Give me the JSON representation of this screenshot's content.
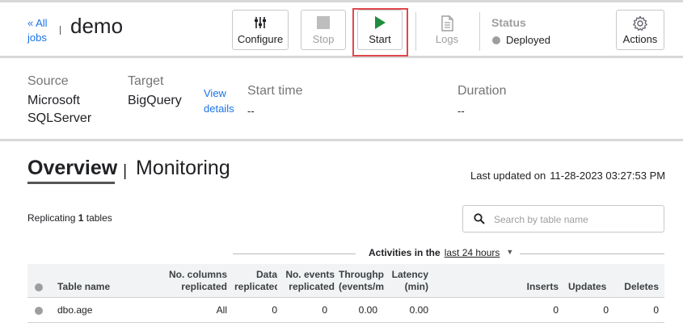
{
  "header": {
    "back_link": "« All jobs",
    "title": "demo",
    "buttons": {
      "configure": "Configure",
      "stop": "Stop",
      "start": "Start",
      "logs": "Logs",
      "actions": "Actions"
    },
    "status_label": "Status",
    "status_value": "Deployed"
  },
  "info": {
    "source_label": "Source",
    "source_value": "Microsoft SQLServer",
    "target_label": "Target",
    "target_value": "BigQuery",
    "view_details": "View details",
    "start_time_label": "Start time",
    "start_time_value": "--",
    "duration_label": "Duration",
    "duration_value": "--"
  },
  "overview": {
    "tab_overview": "Overview",
    "tab_sep": "|",
    "tab_monitoring": "Monitoring",
    "last_updated_label": "Last updated on",
    "last_updated_value": "11-28-2023 03:27:53 PM",
    "replicating_prefix": "Replicating",
    "replicating_count": "1",
    "replicating_suffix": "tables",
    "search_placeholder": "Search by table name",
    "activities_label": "Activities in the",
    "activities_period": "last 24 hours"
  },
  "table": {
    "headers": {
      "table_name": "Table name",
      "no_columns": "No. columns replicated",
      "data_replicated": "Data replicated",
      "no_events": "No. events replicated",
      "throughput": "Throughput (events/min)",
      "latency": "Latency (min)",
      "inserts": "Inserts",
      "updates": "Updates",
      "deletes": "Deletes"
    },
    "rows": [
      {
        "table_name": "dbo.age",
        "no_columns": "All",
        "data_replicated": "0",
        "no_events": "0",
        "throughput": "0.00",
        "latency": "0.00",
        "inserts": "0",
        "updates": "0",
        "deletes": "0"
      }
    ]
  },
  "colors": {
    "accent": "#1a73e8",
    "start_icon": "#1e8e3e",
    "highlight": "#e0474c",
    "status_dot": "#9e9e9e"
  },
  "icons": {
    "configure": "sliders-icon",
    "stop": "stop-square-icon",
    "start": "play-icon",
    "logs": "document-icon",
    "actions": "gear-icon",
    "search": "search-icon"
  }
}
